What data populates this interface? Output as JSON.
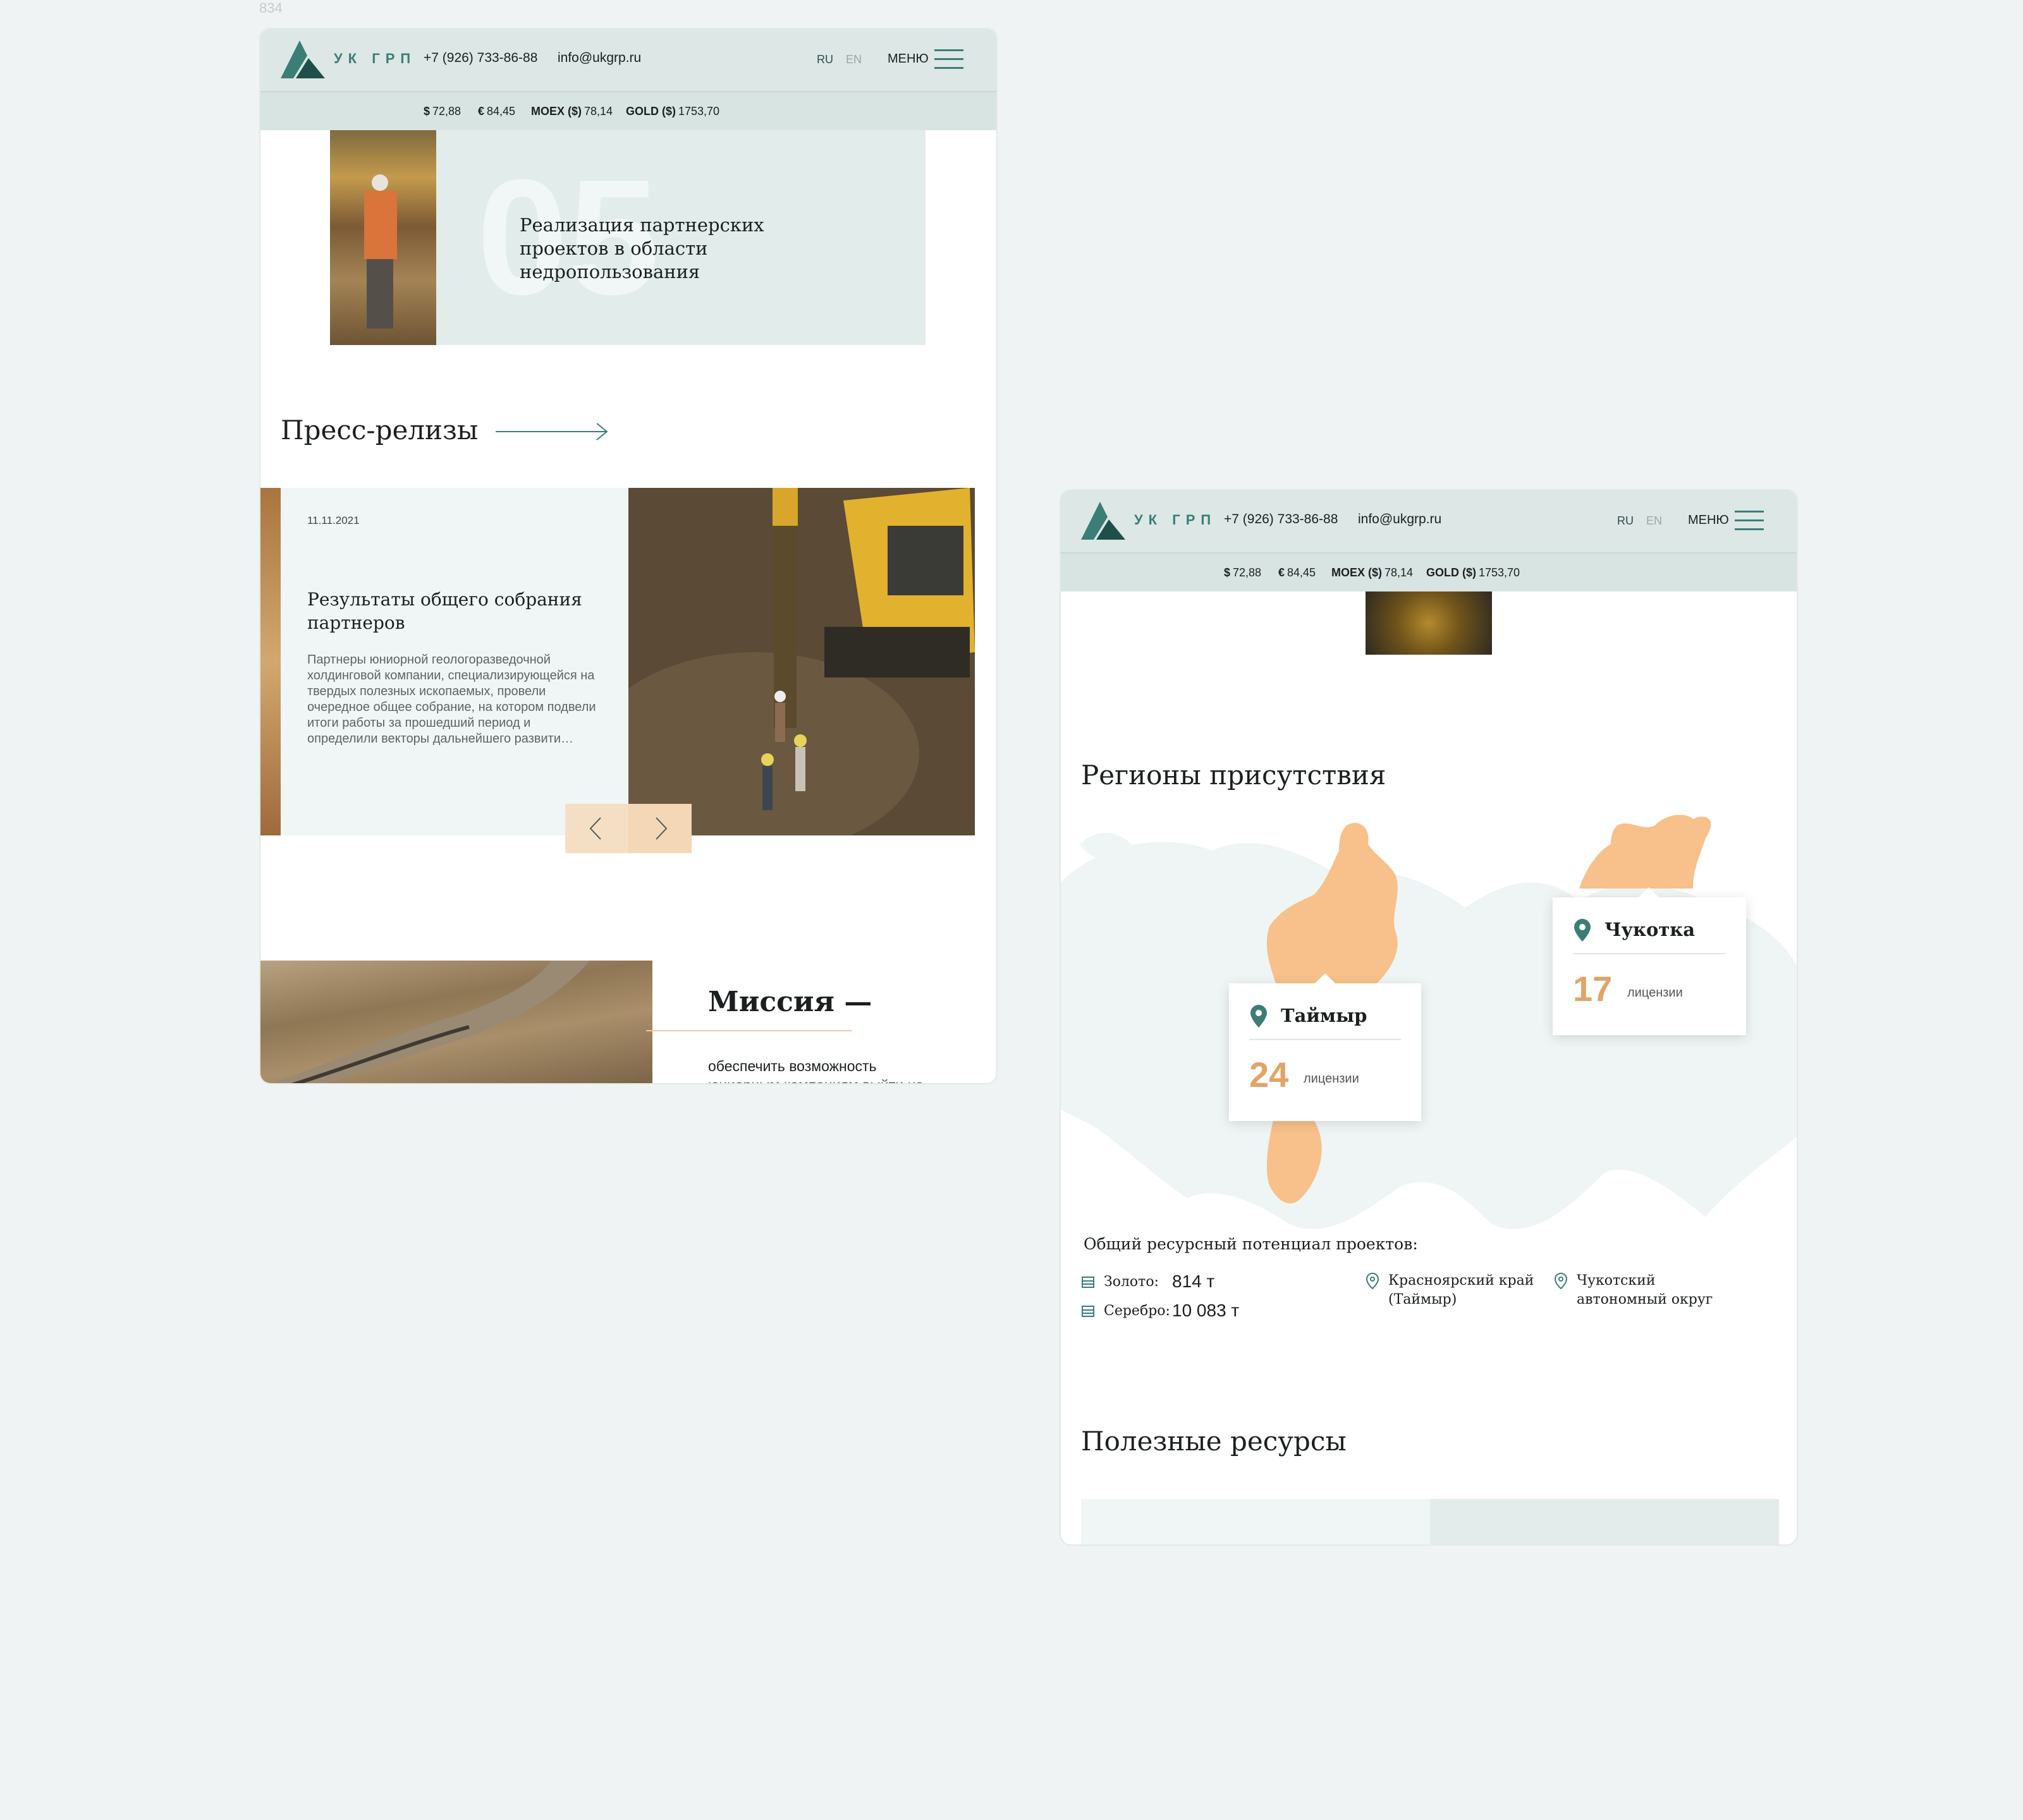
{
  "canvas": {
    "label": "834"
  },
  "header": {
    "brand": "УК ГРП",
    "phone": "+7 (926) 733-86-88",
    "email": "info@ukgrp.ru",
    "lang_ru": "RU",
    "lang_en": "EN",
    "menu": "МЕНЮ"
  },
  "ticker": [
    {
      "label": "$",
      "value": "72,88"
    },
    {
      "label": "€",
      "value": "84,45"
    },
    {
      "label": "MOEX ($)",
      "value": "78,14"
    },
    {
      "label": "GOLD ($)",
      "value": "1753,70"
    }
  ],
  "left": {
    "card": {
      "number": "05",
      "text": "Реализация партнерских проектов в области недропользования"
    },
    "press": {
      "title": "Пресс-релизы",
      "date": "11.11.2021",
      "headline": "Результаты общего собрания партнеров",
      "body": "Партнеры юниорной геологоразведочной холдинговой компании, специализирующейся на твердых полезных ископаемых, провели очередное общее собрание, на котором подвели итоги работы за прошедший период и определили векторы дальнейшего развити…"
    },
    "mission": {
      "title": "Миссия —",
      "text": "обеспечить возможность",
      "text2": "юниорным компаниям выйти на"
    }
  },
  "right": {
    "regions_title": "Регионы присутствия",
    "popups": [
      {
        "name": "Таймыр",
        "count": "24",
        "unit": "лицензии"
      },
      {
        "name": "Чукотка",
        "count": "17",
        "unit": "лицензии"
      }
    ],
    "potential_title": "Общий ресурсный потенциал проектов:",
    "resources": [
      {
        "label": "Золото:",
        "value": "814 т"
      },
      {
        "label": "Серебро:",
        "value": "10 083 т"
      }
    ],
    "locations": [
      "Красноярский край (Таймыр)",
      "Чукотский автономный округ"
    ],
    "useful_title": "Полезные ресурсы"
  },
  "colors": {
    "accent_teal": "#3a7e76",
    "region_orange": "#f8c08a",
    "number_orange": "#e2a467",
    "panel_mint": "#e2eceb"
  }
}
